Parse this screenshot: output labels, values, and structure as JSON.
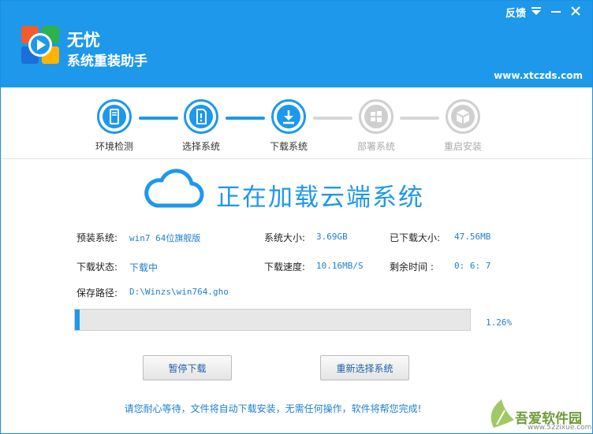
{
  "header": {
    "brand_line1": "无忧",
    "brand_line2": "系统重装助手",
    "feedback_label": "反馈",
    "website": "www.xtczds.com"
  },
  "steps": [
    {
      "label": "环境检测",
      "state": "done"
    },
    {
      "label": "选择系统",
      "state": "done"
    },
    {
      "label": "下载系统",
      "state": "active"
    },
    {
      "label": "部署系统",
      "state": "pending"
    },
    {
      "label": "重启安装",
      "state": "pending"
    }
  ],
  "status": {
    "headline": "正在加载云端系统"
  },
  "info": {
    "preinstall_label": "预装系统:",
    "preinstall_value": "win7  64位旗舰版",
    "size_label": "系统大小:",
    "size_value": "3.69GB",
    "downloaded_label": "已下载大小:",
    "downloaded_value": "47.56MB",
    "state_label": "下载状态:",
    "state_value": "下载中",
    "speed_label": "下载速度:",
    "speed_value": "10.16MB/S",
    "remaining_label": "剩余时间 :",
    "remaining_value": "0: 6: 7",
    "path_label": "保存路径:",
    "path_value": "D:\\Winzs\\win764.gho"
  },
  "progress": {
    "percent_value": 1.26,
    "percent_text": "1.26%"
  },
  "buttons": {
    "pause": "暂停下载",
    "reselect": "重新选择系统"
  },
  "notice": "请您耐心等待，文件将自动下载安装，无需任何操作，软件将帮您完成!",
  "watermark": {
    "brand": "吾爱软件园",
    "url": "www.52zixue.com"
  },
  "colors": {
    "accent": "#1e98ea",
    "inactive": "#cfcfcf"
  }
}
